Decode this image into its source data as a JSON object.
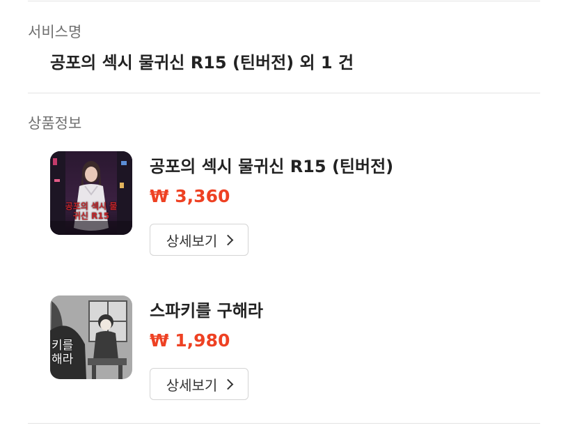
{
  "service": {
    "label": "서비스명",
    "name": "공포의 섹시 물귀신 R15 (틴버전) 외 1 건"
  },
  "products": {
    "label": "상품정보",
    "items": [
      {
        "title": "공포의 섹시 물귀신 R15 (틴버전)",
        "price": "₩ 3,360",
        "detail_label": "상세보기",
        "thumb_text": "공포의 섹시 물귀신 R15"
      },
      {
        "title": "스파키를 구해라",
        "price": "₩ 1,980",
        "detail_label": "상세보기",
        "thumb_text": "키를 해라"
      }
    ]
  },
  "colors": {
    "price": "#ee4123",
    "divider": "#e3e3e3",
    "label": "#6f6f6f"
  },
  "icons": [
    "chevron-right-icon"
  ]
}
